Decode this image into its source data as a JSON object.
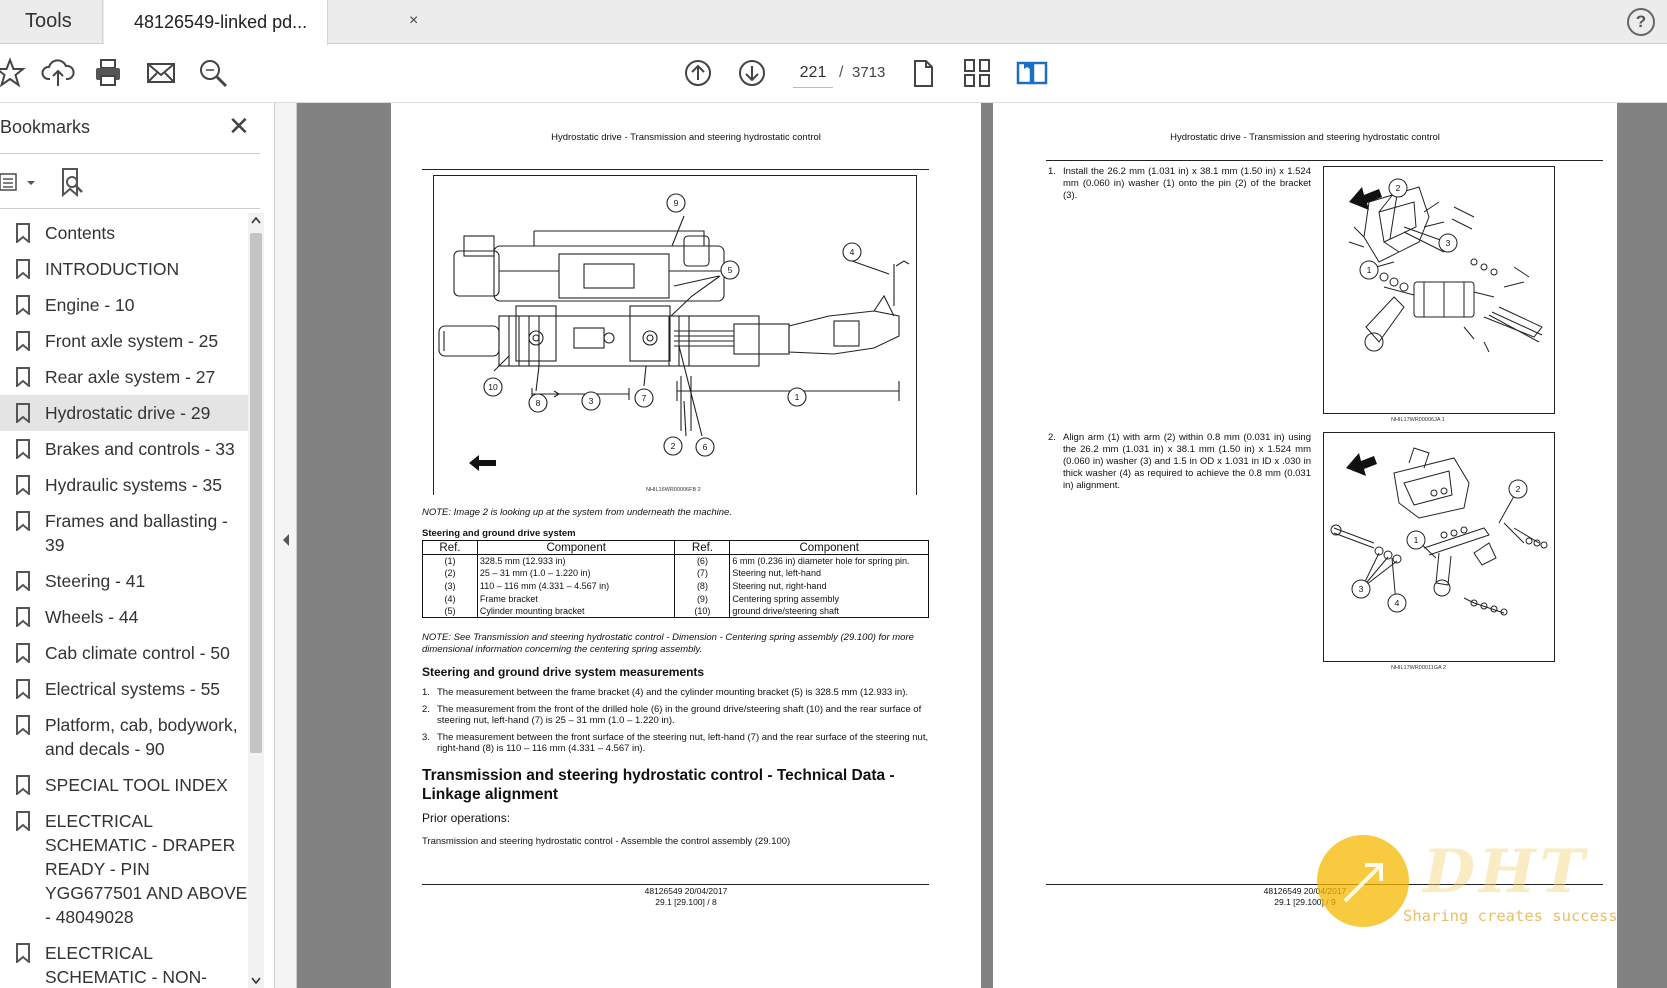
{
  "tabs": {
    "tools_label": "Tools",
    "doc_label": "48126549-linked pd...",
    "close_glyph": "×",
    "help_glyph": "?"
  },
  "toolbar": {
    "current_page": "221",
    "separator": "/",
    "total_pages": "3713"
  },
  "sidebar": {
    "title": "Bookmarks",
    "close_glyph": "✕",
    "items": [
      {
        "label": "Contents"
      },
      {
        "label": "INTRODUCTION"
      },
      {
        "label": "Engine - 10"
      },
      {
        "label": "Front axle system - 25"
      },
      {
        "label": "Rear axle system - 27"
      },
      {
        "label": "Hydrostatic drive - 29"
      },
      {
        "label": "Brakes and controls - 33"
      },
      {
        "label": "Hydraulic systems - 35"
      },
      {
        "label": "Frames and ballasting - 39"
      },
      {
        "label": "Steering - 41"
      },
      {
        "label": "Wheels - 44"
      },
      {
        "label": "Cab climate control - 50"
      },
      {
        "label": "Electrical systems - 55"
      },
      {
        "label": "Platform, cab, bodywork, and decals - 90"
      },
      {
        "label": "SPECIAL TOOL INDEX"
      },
      {
        "label": "ELECTRICAL SCHEMATIC - DRAPER READY - PIN YGG677501 AND ABOVE - 48049028"
      },
      {
        "label": "ELECTRICAL SCHEMATIC - NON-DRAPER READY"
      }
    ]
  },
  "left_page": {
    "running_head": "Hydrostatic drive - Transmission and steering hydrostatic control",
    "figure_caption": "NHIL16WR00006FB  2",
    "note1": "NOTE: Image 2 is looking up at the system from underneath the machine.",
    "table_title": "Steering and ground drive system",
    "table_headers": [
      "Ref.",
      "Component",
      "Ref.",
      "Component"
    ],
    "table_rows": [
      [
        "(1)",
        "328.5 mm (12.933 in)",
        "(6)",
        "6 mm (0.236 in) diameter hole for spring pin."
      ],
      [
        "(2)",
        "25 – 31 mm (1.0 – 1.220 in)",
        "(7)",
        "Steering nut, left-hand"
      ],
      [
        "(3)",
        "110 – 116 mm (4.331 – 4.567 in)",
        "(8)",
        "Steering nut, right-hand"
      ],
      [
        "(4)",
        "Frame bracket",
        "(9)",
        "Centering spring assembly"
      ],
      [
        "(5)",
        "Cylinder mounting bracket",
        "(10)",
        "ground drive/steering shaft"
      ]
    ],
    "note2": "NOTE: See Transmission and steering hydrostatic control - Dimension - Centering spring assembly (29.100) for more dimensional information concerning the centering spring assembly.",
    "section_heading": "Steering and ground drive system measurements",
    "measurements": [
      "The measurement between the frame bracket (4) and the cylinder mounting bracket (5) is 328.5 mm (12.933 in).",
      "The measurement from the front of the drilled hole (6) in the ground drive/steering shaft (10) and the rear surface of steering nut, left-hand (7) is 25 – 31 mm (1.0 – 1.220 in).",
      "The measurement between the front surface of the steering nut, left-hand (7) and the rear surface of the steering nut, right-hand (8) is 110 – 116 mm (4.331 – 4.567 in)."
    ],
    "tech_heading": "Transmission and steering hydrostatic control - Technical Data - Linkage alignment",
    "prior_ops_label": "Prior operations:",
    "prior_ops_link": "Transmission and steering hydrostatic control - Assemble the control assembly (29.100)",
    "footer_line1": "48126549 20/04/2017",
    "footer_line2": "29.1 [29.100] / 8",
    "callouts": [
      "9",
      "4",
      "5",
      "10",
      "8",
      "3",
      "7",
      "1",
      "2",
      "6"
    ]
  },
  "right_page": {
    "running_head": "Hydrostatic drive - Transmission and steering hydrostatic control",
    "step1": "Install the 26.2 mm (1.031 in) x 38.1 mm (1.50 in) x 1.524 mm (0.060 in) washer (1) onto the pin (2) of the bracket (3).",
    "step2": "Align arm (1) with arm (2) within 0.8 mm (0.031 in) using the 26.2 mm (1.031 in) x 38.1 mm (1.50 in) x 1.524 mm (0.060 in) washer (3) and 1.5 in OD x 1.031 in ID x .030 in thick washer (4) as required to achieve the 0.8 mm (0.031 in) alignment.",
    "fig1_caption": "NHIL17WR00006JA  1",
    "fig2_caption": "NHIL17WR00011GA  2",
    "fig1_callouts": [
      "2",
      "3",
      "1"
    ],
    "fig2_callouts": [
      "2",
      "1",
      "3",
      "4"
    ],
    "footer_line1": "48126549 20/04/2017",
    "footer_line2": "29.1 [29.100] / 9"
  },
  "watermark": {
    "text": "DHT",
    "tagline": "Sharing creates success"
  }
}
